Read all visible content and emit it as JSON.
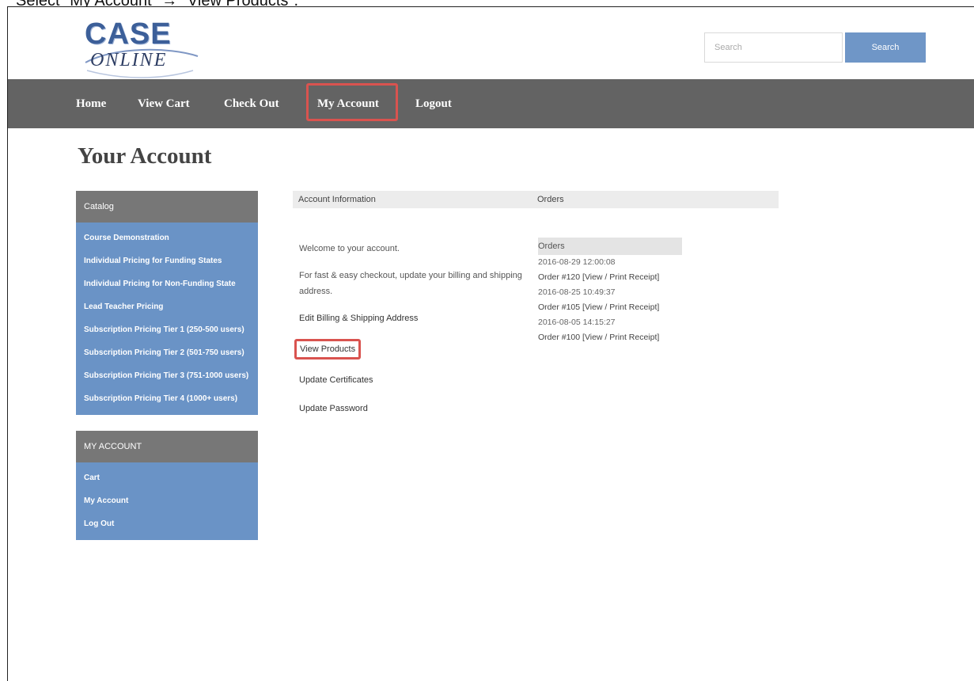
{
  "caption": "Select \"My Account\" → \"View Products\".",
  "logo": {
    "line1": "CASE",
    "line2": "ONLINE"
  },
  "search": {
    "placeholder": "Search",
    "button": "Search"
  },
  "nav": {
    "items": [
      "Home",
      "View Cart",
      "Check Out",
      "My Account",
      "Logout"
    ]
  },
  "page_title": "Your Account",
  "sidebar": {
    "catalog": {
      "title": "Catalog",
      "items": [
        "Course Demonstration",
        "Individual Pricing for Funding States",
        "Individual Pricing for Non-Funding State",
        "Lead Teacher Pricing",
        "Subscription Pricing Tier 1 (250-500 users)",
        "Subscription Pricing Tier 2 (501-750 users)",
        "Subscription Pricing Tier 3 (751-1000 users)",
        "Subscription Pricing Tier 4 (1000+ users)"
      ]
    },
    "account": {
      "title": "MY ACCOUNT",
      "items": [
        "Cart",
        "My Account",
        "Log Out"
      ]
    }
  },
  "tabs": {
    "account_info": "Account Information",
    "orders": "Orders"
  },
  "account": {
    "welcome": "Welcome to your account.",
    "checkout_note": "For fast & easy checkout, update your billing and shipping address.",
    "links": [
      "Edit Billing & Shipping Address",
      "View Products",
      "Update Certificates",
      "Update Password"
    ]
  },
  "orders": {
    "title": "Orders",
    "entries": [
      {
        "date": "2016-08-29 12:00:08",
        "order": "Order #120 [View / Print Receipt]"
      },
      {
        "date": "2016-08-25 10:49:37",
        "order": "Order #105 [View / Print Receipt]"
      },
      {
        "date": "2016-08-05 14:15:27",
        "order": "Order #100 [View / Print Receipt]"
      }
    ]
  },
  "colors": {
    "nav_bg": "#636363",
    "sidebar_bg": "#6a93c6",
    "highlight": "#d9534f",
    "search_button": "#6f96c7"
  }
}
